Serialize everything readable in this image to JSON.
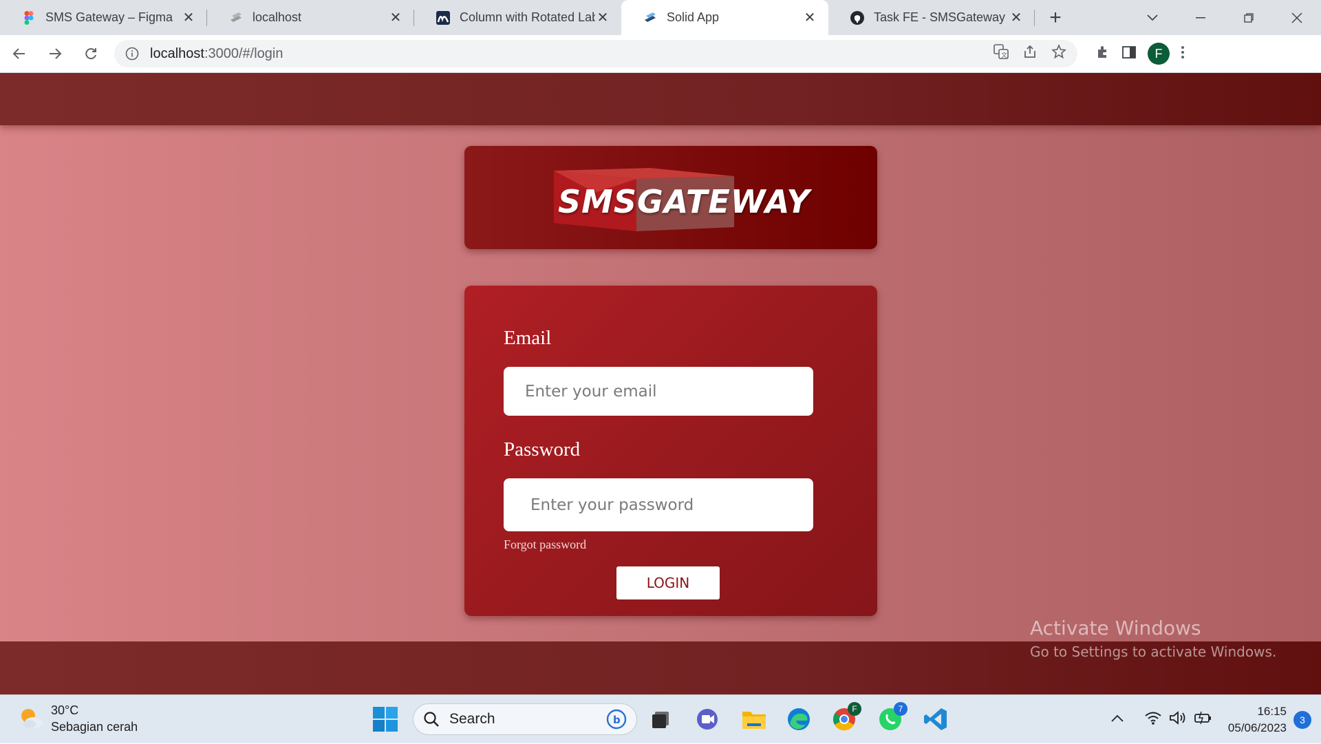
{
  "browser": {
    "tabs": [
      {
        "title": "SMS Gateway – Figma",
        "icon": "figma-icon",
        "active": false
      },
      {
        "title": "localhost",
        "icon": "solid-icon",
        "active": false
      },
      {
        "title": "Column with Rotated Lab",
        "icon": "amcharts-icon",
        "active": false
      },
      {
        "title": "Solid App",
        "icon": "solid-icon",
        "active": true
      },
      {
        "title": "Task FE - SMSGateway Pro",
        "icon": "github-icon",
        "active": false
      }
    ],
    "new_tab_label": "+",
    "url_host": "localhost",
    "url_path": ":3000/#/login",
    "profile_initial": "F"
  },
  "app": {
    "logo_text": "SMSGATEWAY",
    "email_label": "Email",
    "email_placeholder": "Enter your email",
    "email_value": "",
    "password_label": "Password",
    "password_placeholder": "Enter your password",
    "password_value": "",
    "forgot_label": "Forgot password",
    "login_label": "LOGIN",
    "colors": {
      "header": "#722222",
      "card": "#991a1e",
      "page_bg": "#c9777a"
    }
  },
  "watermark": {
    "title": "Activate Windows",
    "subtitle": "Go to Settings to activate Windows."
  },
  "taskbar": {
    "weather_temp": "30°C",
    "weather_desc": "Sebagian cerah",
    "search_label": "Search",
    "whatsapp_badge": "7",
    "chrome_profile_badge": "F",
    "time": "16:15",
    "date": "05/06/2023",
    "notifications": "3"
  }
}
